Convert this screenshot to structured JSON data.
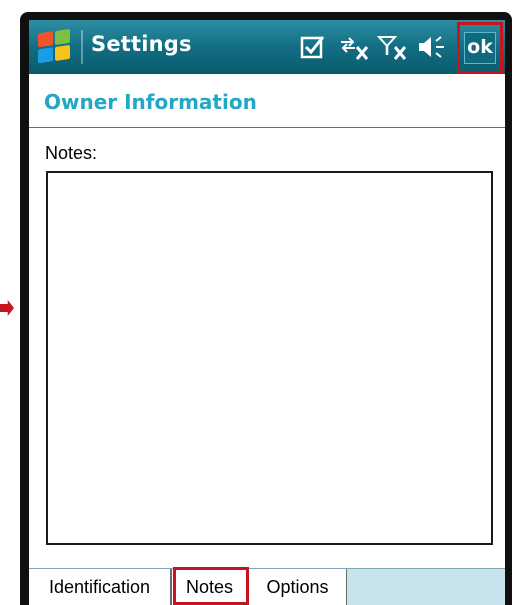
{
  "titlebar": {
    "title": "Settings",
    "ok_label": "ok",
    "icons": [
      "windows-start-icon",
      "checkbox-icon",
      "connectivity-icon",
      "signal-off-icon",
      "volume-icon"
    ]
  },
  "header": {
    "title": "Owner Information"
  },
  "notes": {
    "label": "Notes:",
    "value": ""
  },
  "tabs": [
    {
      "label": "Identification",
      "selected": false
    },
    {
      "label": "Notes",
      "selected": true
    },
    {
      "label": "Options",
      "selected": false
    }
  ],
  "colors": {
    "titlebar": "#136f84",
    "header_text": "#22a7c4",
    "highlight": "#c8141e",
    "tabstrip": "#c9e3ec"
  }
}
